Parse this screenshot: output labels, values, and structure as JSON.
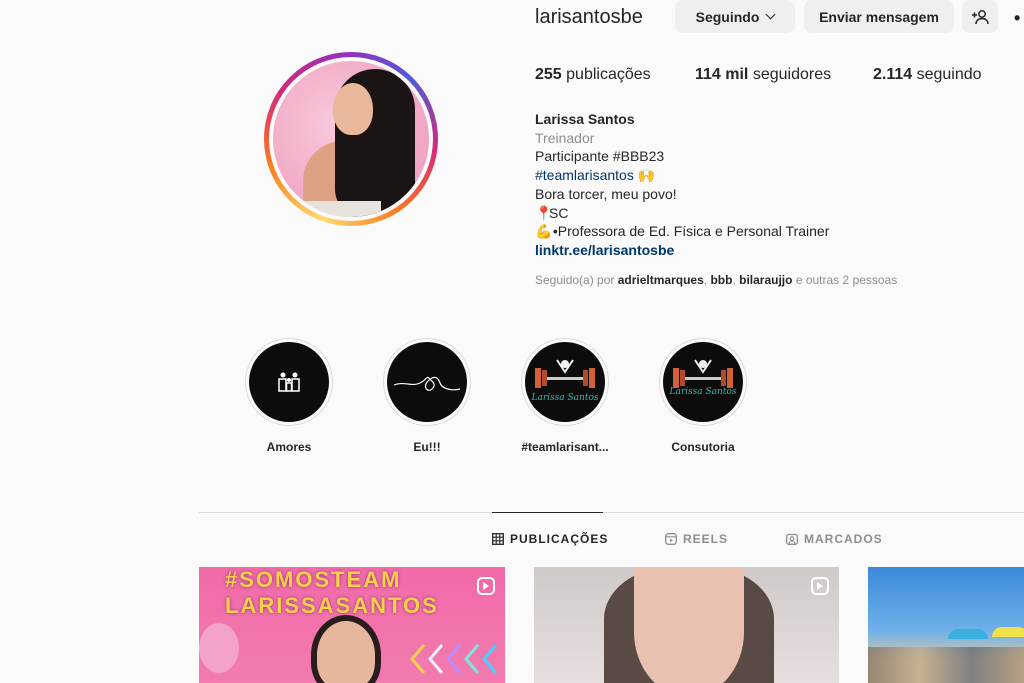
{
  "profile": {
    "username": "larisantosbe",
    "follow_label": "Seguindo",
    "message_label": "Enviar mensagem",
    "more_label": "•",
    "stats": {
      "posts_value": "255",
      "posts_label": "publicações",
      "followers_value": "114 mil",
      "followers_label": "seguidores",
      "following_value": "2.114",
      "following_label": "seguindo"
    },
    "bio": {
      "name": "Larissa Santos",
      "category": "Treinador",
      "line1": "Participante #BBB23",
      "hashtag": "#teamlarisantos",
      "hashtag_emoji": "🙌",
      "line3": "Bora torcer, meu povo!",
      "pin_emoji": "📍",
      "line4": "SC",
      "arm_emoji": "💪",
      "line5": "•Professora de Ed. Física e Personal Trainer",
      "link": "linktr.ee/larisantosbe"
    },
    "followed_by": {
      "prefix": "Seguido(a) por",
      "user1": "adrieltmarques",
      "user2": "bbb",
      "user3": "bilaraujjo",
      "suffix": "e outras 2 pessoas"
    }
  },
  "highlights": [
    {
      "label": "Amores"
    },
    {
      "label": "Eu!!!"
    },
    {
      "label": "#teamlarisant..."
    },
    {
      "label": "Consutoria"
    }
  ],
  "highlight_art_text": "Larissa Santos",
  "tabs": [
    {
      "label": "PUBLICAÇÕES",
      "icon": "grid-icon",
      "active": true
    },
    {
      "label": "REELS",
      "icon": "reels-icon",
      "active": false
    },
    {
      "label": "MARCADOS",
      "icon": "tagged-icon",
      "active": false
    }
  ],
  "posts": {
    "post1_text": "#SOMOSTEAM LARISSASANTOS"
  },
  "colors": {
    "link": "#00376b",
    "secondary_text": "#8e8e8e",
    "button_bg": "#efefef"
  }
}
